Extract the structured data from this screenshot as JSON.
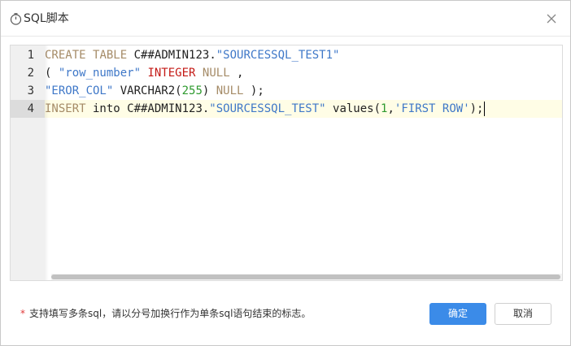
{
  "dialog": {
    "title": "SQL脚本",
    "title_icon": "timer-icon",
    "close_icon": "close-icon"
  },
  "editor": {
    "lines": [
      {
        "number": "1",
        "tokens": [
          {
            "type": "kw",
            "text": "CREATE"
          },
          {
            "type": "plain",
            "text": " "
          },
          {
            "type": "kw",
            "text": "TABLE"
          },
          {
            "type": "plain",
            "text": " C##ADMIN123."
          },
          {
            "type": "str",
            "text": "\"SOURCESSQL_TEST1\""
          }
        ]
      },
      {
        "number": "2",
        "tokens": [
          {
            "type": "plain",
            "text": "( "
          },
          {
            "type": "str",
            "text": "\"row_number\""
          },
          {
            "type": "plain",
            "text": " "
          },
          {
            "type": "ty",
            "text": "INTEGER"
          },
          {
            "type": "plain",
            "text": " "
          },
          {
            "type": "kw",
            "text": "NULL"
          },
          {
            "type": "plain",
            "text": " ,"
          }
        ]
      },
      {
        "number": "3",
        "tokens": [
          {
            "type": "str",
            "text": "\"EROR_COL\""
          },
          {
            "type": "plain",
            "text": " VARCHAR2("
          },
          {
            "type": "num",
            "text": "255"
          },
          {
            "type": "plain",
            "text": ") "
          },
          {
            "type": "kw",
            "text": "NULL"
          },
          {
            "type": "plain",
            "text": " );"
          }
        ]
      },
      {
        "number": "4",
        "tokens": [
          {
            "type": "kw",
            "text": "INSERT"
          },
          {
            "type": "plain",
            "text": " into C##ADMIN123."
          },
          {
            "type": "str",
            "text": "\"SOURCESSQL_TEST\""
          },
          {
            "type": "plain",
            "text": " values("
          },
          {
            "type": "num",
            "text": "1"
          },
          {
            "type": "plain",
            "text": ","
          },
          {
            "type": "str",
            "text": "'FIRST ROW'"
          },
          {
            "type": "plain",
            "text": ");"
          }
        ]
      }
    ],
    "active_line": 4
  },
  "footer": {
    "required_mark": "*",
    "hint": "支持填写多条sql，请以分号加换行作为单条sql语句结束的标志。",
    "confirm_label": "确定",
    "cancel_label": "取消"
  },
  "colors": {
    "keyword": "#a58b67",
    "string": "#3f78c8",
    "type": "#c41a16",
    "number": "#2e9a2e",
    "primary_button": "#3b8be8",
    "required_mark": "#e03a3a"
  }
}
